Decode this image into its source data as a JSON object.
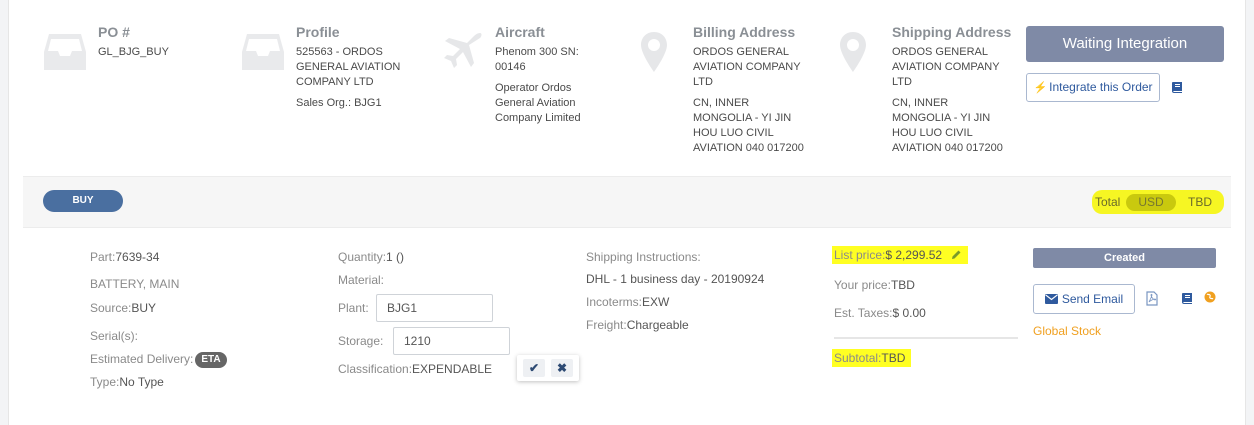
{
  "header": {
    "po": {
      "title": "PO #",
      "value": "GL_BJG_BUY",
      "icon": "inbox-icon"
    },
    "profile": {
      "title": "Profile",
      "lines": [
        "525563 - ORDOS",
        "GENERAL AVIATION",
        "COMPANY LTD"
      ],
      "sales_org": "Sales Org.: BJG1",
      "icon": "inbox-icon"
    },
    "aircraft": {
      "title": "Aircraft",
      "lines": [
        "Phenom 300 SN:",
        "00146"
      ],
      "operator_lines": [
        "Operator Ordos",
        "General Aviation",
        "Company Limited"
      ],
      "icon": "airplane-icon"
    },
    "billing": {
      "title": "Billing Address",
      "name_lines": [
        "ORDOS GENERAL",
        "AVIATION COMPANY",
        "LTD"
      ],
      "address_lines": [
        "CN, INNER",
        "MONGOLIA - YI JIN",
        "HOU LUO CIVIL",
        "AVIATION 040 017200"
      ],
      "icon": "map-pin-icon"
    },
    "shipping": {
      "title": "Shipping Address",
      "name_lines": [
        "ORDOS GENERAL",
        "AVIATION COMPANY",
        "LTD"
      ],
      "address_lines": [
        "CN, INNER",
        "MONGOLIA - YI JIN",
        "HOU LUO CIVIL",
        "AVIATION 040 017200"
      ],
      "icon": "map-pin-icon"
    },
    "status_button": "Waiting Integration",
    "integrate_button": "Integrate this Order"
  },
  "bar": {
    "type_pill": "BUY",
    "total_label": "Total",
    "currency": "USD",
    "total_value": "TBD"
  },
  "item": {
    "part_label": "Part:",
    "part_value": "7639-34",
    "description": "BATTERY, MAIN",
    "source_label": "Source:",
    "source_value": "BUY",
    "serial_label": "Serial(s):",
    "est_delivery_label": "Estimated Delivery:",
    "eta_badge": "ETA",
    "type_label": "Type:",
    "type_value": "No Type",
    "quantity_label": "Quantity:",
    "quantity_value": "1 ()",
    "material_label": "Material:",
    "plant_label": "Plant:",
    "plant_value": "BJG1",
    "storage_label": "Storage:",
    "storage_value": "1210",
    "classification_label": "Classification:",
    "classification_value": "EXPENDABLE",
    "shipping_instructions_label": "Shipping Instructions:",
    "shipping_instructions_value": "DHL - 1 business day - 20190924",
    "incoterms_label": "Incoterms:",
    "incoterms_value": "EXW",
    "freight_label": "Freight:",
    "freight_value": "Chargeable",
    "list_price_label": "List price:",
    "list_price_value": "$ 2,299.52",
    "your_price_label": "Your price:",
    "your_price_value": "TBD",
    "est_taxes_label": "Est. Taxes:",
    "est_taxes_value": "$ 0.00",
    "subtotal_label": "Subtotal:",
    "subtotal_value": "TBD",
    "status_badge": "Created",
    "send_email_button": "Send Email",
    "stock_label": "Global Stock"
  },
  "colors": {
    "status_button_bg": "#7f8aa6",
    "pill_blue": "#4a6fa0",
    "link_blue": "#2f5a9e",
    "highlight": "#ffff22",
    "stock_orange": "#f0a020"
  }
}
